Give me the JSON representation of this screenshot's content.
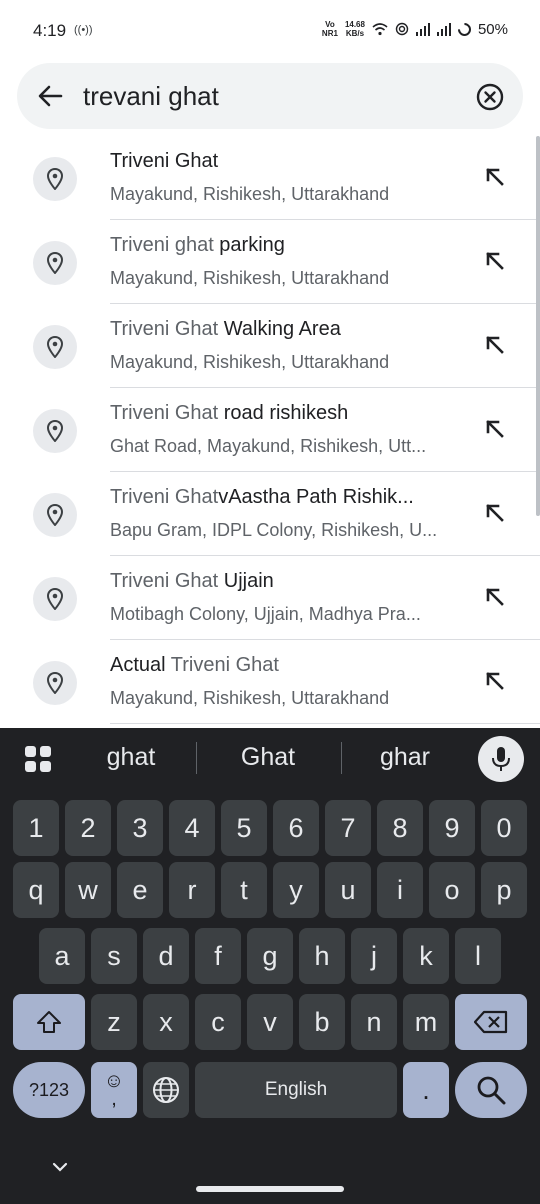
{
  "status": {
    "time": "4:19",
    "signal_hint": "((•))",
    "network_label_top": "Vo",
    "network_label_bottom": "NR1",
    "speed_top": "14.68",
    "speed_bottom": "KB/s",
    "battery": "50%"
  },
  "search": {
    "query": "trevani ghat"
  },
  "results": [
    {
      "title_normal": "",
      "title_bold": "Triveni Ghat",
      "title_tail": "",
      "subtitle": "Mayakund, Rishikesh, Uttarakhand"
    },
    {
      "title_normal": "Triveni ghat",
      "title_bold": " parking",
      "title_tail": "",
      "subtitle": "Mayakund, Rishikesh, Uttarakhand"
    },
    {
      "title_normal": "Triveni Ghat",
      "title_bold": " Walking Area",
      "title_tail": "",
      "subtitle": "Mayakund, Rishikesh, Uttarakhand"
    },
    {
      "title_normal": "Triveni Ghat",
      "title_bold": " road rishikesh",
      "title_tail": "",
      "subtitle": "Ghat Road, Mayakund, Rishikesh, Utt..."
    },
    {
      "title_normal": "Triveni Ghat",
      "title_bold": "vAastha Path Rishik...",
      "title_tail": "",
      "subtitle": "Bapu Gram, IDPL Colony, Rishikesh, U..."
    },
    {
      "title_normal": "Triveni Ghat",
      "title_bold": " Ujjain",
      "title_tail": "",
      "subtitle": "Motibagh Colony, Ujjain, Madhya Pra..."
    },
    {
      "title_normal": "",
      "title_bold": "Actual ",
      "title_tail": "Triveni Ghat",
      "subtitle": "Mayakund, Rishikesh, Uttarakhand"
    }
  ],
  "keyboard": {
    "suggestions": [
      "ghat",
      "Ghat",
      "ghar"
    ],
    "row_numbers": [
      "1",
      "2",
      "3",
      "4",
      "5",
      "6",
      "7",
      "8",
      "9",
      "0"
    ],
    "row1": [
      "q",
      "w",
      "e",
      "r",
      "t",
      "y",
      "u",
      "i",
      "o",
      "p"
    ],
    "row2": [
      "a",
      "s",
      "d",
      "f",
      "g",
      "h",
      "j",
      "k",
      "l"
    ],
    "row3": [
      "z",
      "x",
      "c",
      "v",
      "b",
      "n",
      "m"
    ],
    "symbols_label": "?123",
    "emoji_label": "☺",
    "emoji_sub": ",",
    "space_label": "English",
    "period_label": "."
  },
  "colors": {
    "keyboard_bg": "#202124",
    "key_bg": "#3c4043",
    "special_key_bg": "#a7b3cf",
    "search_bg": "#f1f3f4"
  }
}
